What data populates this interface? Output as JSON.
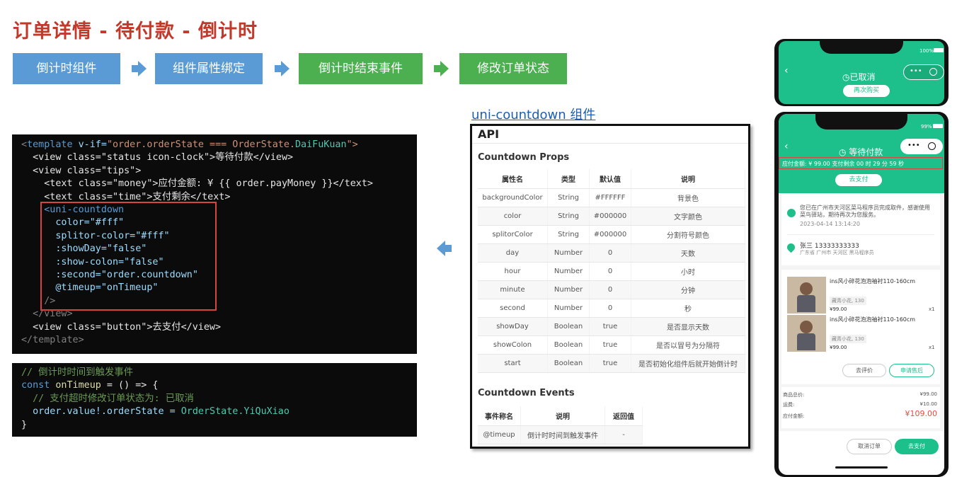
{
  "title": "订单详情 - 待付款 - 倒计时",
  "flow": {
    "steps": [
      "倒计时组件",
      "组件属性绑定",
      "倒计时结束事件",
      "修改订单状态"
    ]
  },
  "code_template": {
    "l1_tag": "<template",
    "l1_attr": " v-if=",
    "l1_str": "\"order.orderState === OrderState.",
    "l1_cls": "DaiFuKuan",
    "l1_end": "\">",
    "l2": "<view class=\"status icon-clock\">等待付款</view>",
    "l3": "<view class=\"tips\">",
    "l4": "<text class=\"money\">应付金额: ¥ {{ order.payMoney }}</text>",
    "l5": "<text class=\"time\">支付剩余</text>",
    "l6": "<uni-countdown",
    "l7": "color=\"#fff\"",
    "l8": "splitor-color=\"#fff\"",
    "l9": ":showDay=\"false\"",
    "l10": ":show-colon=\"false\"",
    "l11": ":second=\"order.countdown\"",
    "l12": "@timeup=\"onTimeup\"",
    "l13": "/>",
    "l14": "</view>",
    "l15": "<view class=\"button\">去支付</view>",
    "l16": "</template>"
  },
  "code_script": {
    "l1": "// 倒计时时间到触发事件",
    "l2a": "const ",
    "l2b": "onTimeup",
    "l2c": " = () => {",
    "l3": "// 支付超时修改订单状态为: 已取消",
    "l4a": "order.value!.orderState = ",
    "l4b": "OrderState.YiQuXiao",
    "l5": "}"
  },
  "doc": {
    "link": "uni-countdown 组件",
    "api": "API",
    "props_title": "Countdown Props",
    "props_headers": [
      "属性名",
      "类型",
      "默认值",
      "说明"
    ],
    "props_rows": [
      [
        "backgroundColor",
        "String",
        "#FFFFFF",
        "背景色"
      ],
      [
        "color",
        "String",
        "#000000",
        "文字颜色"
      ],
      [
        "splitorColor",
        "String",
        "#000000",
        "分割符号颜色"
      ],
      [
        "day",
        "Number",
        "0",
        "天数"
      ],
      [
        "hour",
        "Number",
        "0",
        "小时"
      ],
      [
        "minute",
        "Number",
        "0",
        "分钟"
      ],
      [
        "second",
        "Number",
        "0",
        "秒"
      ],
      [
        "showDay",
        "Boolean",
        "true",
        "是否显示天数"
      ],
      [
        "showColon",
        "Boolean",
        "true",
        "是否以冒号为分隔符"
      ],
      [
        "start",
        "Boolean",
        "true",
        "是否初始化组件后就开始倒计时"
      ]
    ],
    "events_title": "Countdown Events",
    "events_headers": [
      "事件称名",
      "说明",
      "返回值"
    ],
    "events_rows": [
      [
        "@timeup",
        "倒计时时间到触发事件",
        "-"
      ]
    ]
  },
  "phone_top": {
    "battery": "100%",
    "status": "◷已取消",
    "button": "再次购买"
  },
  "phone_main": {
    "battery": "99%",
    "status": "◷ 等待付款",
    "pay_info": "应付金额: ¥ 99.00   支付剩余 00 时 29 分 59 秒",
    "pay_button": "去支付",
    "notice": "您已在广州市天河区菜马程序员完成取件，感谢使用菜鸟驿站，期待再次为您服务。",
    "notice_time": "2023-04-14 13:14:20",
    "contact": "张三 13333333333",
    "address": "广东省 广州市 天河区 黑马程序员",
    "items": [
      {
        "name": "ins风小碎花泡泡袖衬110-160cm",
        "spec": "藏青小花, 130",
        "price": "¥99.00",
        "qty": "x1"
      },
      {
        "name": "ins风小碎花泡泡袖衬110-160cm",
        "spec": "藏青小花, 130",
        "price": "¥99.00",
        "qty": "x1"
      }
    ],
    "btn_review": "去评价",
    "btn_after": "申请售后",
    "sum_label": "商品总价:",
    "sum_value": "¥99.00",
    "ship_label": "运费:",
    "ship_value": "¥10.00",
    "pay_label": "应付金额:",
    "pay_value": "¥109.00",
    "btn_cancel": "取消订单",
    "btn_pay": "去支付"
  },
  "colors": {
    "accent_green": "#1dbf8a",
    "title_red": "#c0392b",
    "flow_blue": "#5b9bd5",
    "flow_green": "#4caf50",
    "highlight_red": "#d64541"
  }
}
